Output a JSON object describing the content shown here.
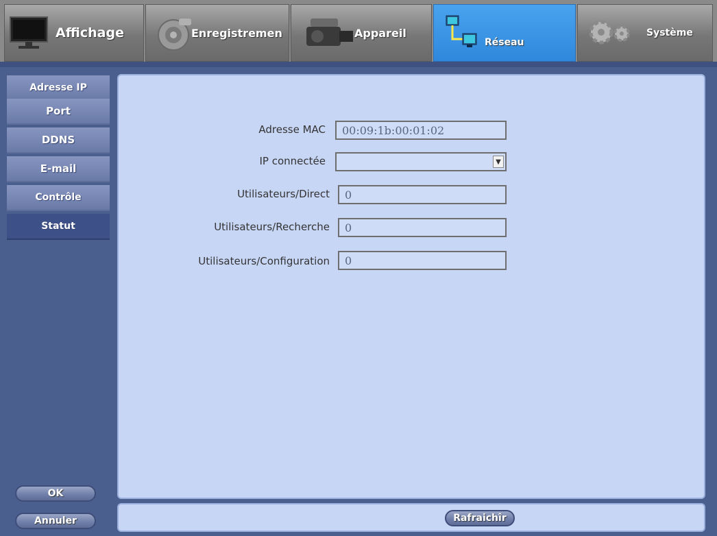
{
  "tabs": [
    {
      "label": "Affichage",
      "icon": "monitor-icon"
    },
    {
      "label": "Enregistremen",
      "icon": "record-icon"
    },
    {
      "label": "Appareil",
      "icon": "camera-icon"
    },
    {
      "label": "Réseau",
      "icon": "network-icon",
      "active": true
    },
    {
      "label": "Système",
      "icon": "gear-icon"
    }
  ],
  "sidebar": {
    "items": [
      {
        "label": "Adresse IP"
      },
      {
        "label": "Port"
      },
      {
        "label": "DDNS"
      },
      {
        "label": "E-mail"
      },
      {
        "label": "Contrôle"
      },
      {
        "label": "Statut",
        "active": true
      }
    ],
    "ok_label": "OK",
    "cancel_label": "Annuler"
  },
  "status": {
    "mac_label": "Adresse MAC",
    "mac_value": "00:09:1b:00:01:02",
    "connected_ip_label": "IP connectée",
    "connected_ip_value": "",
    "users_live_label": "Utilisateurs/Direct",
    "users_live_value": "0",
    "users_search_label": "Utilisateurs/Recherche",
    "users_search_value": "0",
    "users_config_label": "Utilisateurs/Configuration",
    "users_config_value": "0"
  },
  "footer": {
    "refresh_label": "Rafraichîr"
  },
  "colors": {
    "accent": "#2f88dc",
    "panel": "#c8d6f6",
    "sidebar_active": "#3d5088"
  }
}
